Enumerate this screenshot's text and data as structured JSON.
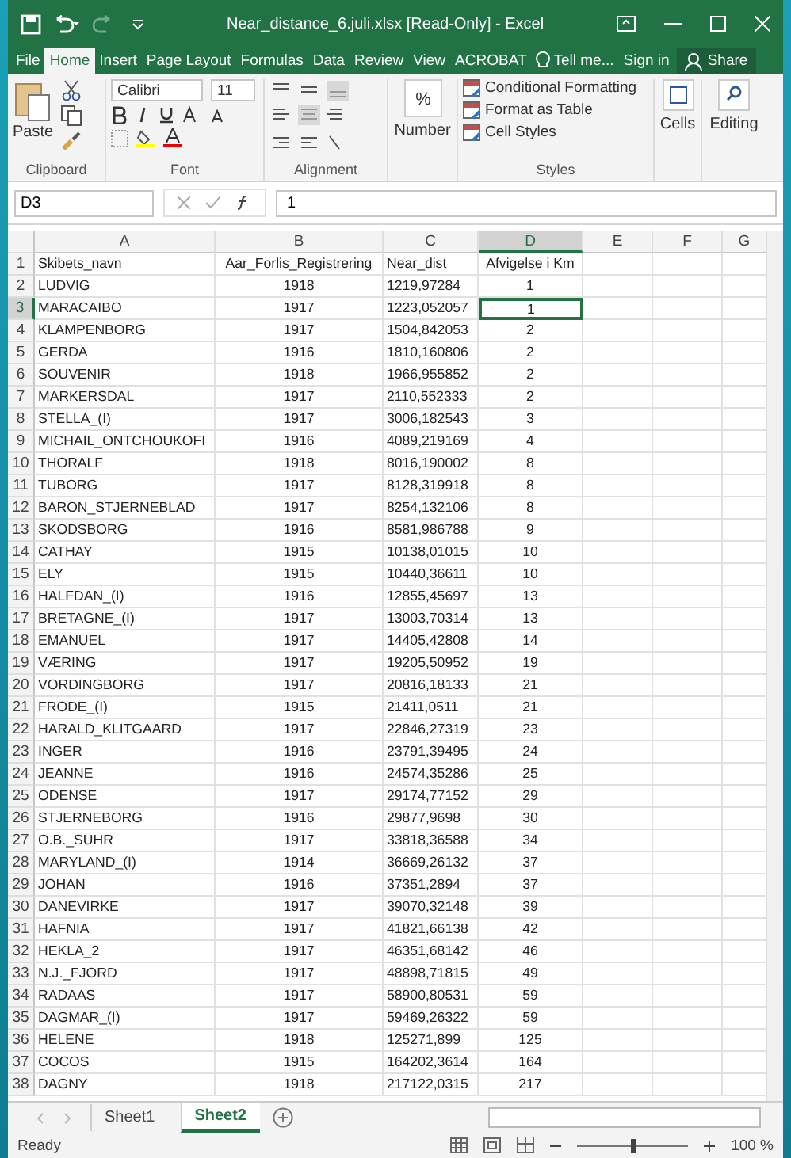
{
  "window": {
    "title": "Near_distance_6.juli.xlsx  [Read-Only] - Excel"
  },
  "ribbon_tabs": [
    {
      "label": "File",
      "selected": false
    },
    {
      "label": "Home",
      "selected": true
    },
    {
      "label": "Insert",
      "selected": false
    },
    {
      "label": "Page Layout",
      "selected": false
    },
    {
      "label": "Formulas",
      "selected": false
    },
    {
      "label": "Data",
      "selected": false
    },
    {
      "label": "Review",
      "selected": false
    },
    {
      "label": "View",
      "selected": false
    },
    {
      "label": "ACROBAT",
      "selected": false
    }
  ],
  "tell_me": "Tell me...",
  "sign_in": "Sign in",
  "share": "Share",
  "ribbon": {
    "clipboard": {
      "paste": "Paste",
      "label": "Clipboard"
    },
    "font": {
      "font_name": "Calibri",
      "font_size": "11",
      "label": "Font"
    },
    "alignment": {
      "label": "Alignment"
    },
    "number": {
      "symbol": "%",
      "button": "Number"
    },
    "styles": {
      "buttons": [
        "Conditional Formatting",
        "Format as Table",
        "Cell Styles"
      ],
      "label": "Styles"
    },
    "cells": {
      "button": "Cells"
    },
    "editing": {
      "button": "Editing"
    }
  },
  "formula_bar": {
    "name_box": "D3",
    "value": "1"
  },
  "columns": [
    {
      "label": "A",
      "selected": false
    },
    {
      "label": "B",
      "selected": false
    },
    {
      "label": "C",
      "selected": false
    },
    {
      "label": "D",
      "selected": true
    },
    {
      "label": "E",
      "selected": false
    },
    {
      "label": "F",
      "selected": false
    },
    {
      "label": "G",
      "selected": false
    }
  ],
  "rows": [
    {
      "number": "1",
      "selected": false,
      "cells": [
        "Skibets_navn",
        "Aar_Forlis_Registrering",
        "Near_dist",
        "Afvigelse i Km"
      ]
    },
    {
      "number": "2",
      "selected": false,
      "cells": [
        "LUDVIG",
        "1918",
        "1219,97284",
        "1"
      ]
    },
    {
      "number": "3",
      "selected": true,
      "cells": [
        "MARACAIBO",
        "1917",
        "1223,052057",
        "1"
      ]
    },
    {
      "number": "4",
      "selected": false,
      "cells": [
        "KLAMPENBORG",
        "1917",
        "1504,842053",
        "2"
      ]
    },
    {
      "number": "5",
      "selected": false,
      "cells": [
        "GERDA",
        "1916",
        "1810,160806",
        "2"
      ]
    },
    {
      "number": "6",
      "selected": false,
      "cells": [
        "SOUVENIR",
        "1918",
        "1966,955852",
        "2"
      ]
    },
    {
      "number": "7",
      "selected": false,
      "cells": [
        "MARKERSDAL",
        "1917",
        "2110,552333",
        "2"
      ]
    },
    {
      "number": "8",
      "selected": false,
      "cells": [
        "STELLA_(I)",
        "1917",
        "3006,182543",
        "3"
      ]
    },
    {
      "number": "9",
      "selected": false,
      "cells": [
        "MICHAIL_ONTCHOUKOFI",
        "1916",
        "4089,219169",
        "4"
      ]
    },
    {
      "number": "10",
      "selected": false,
      "cells": [
        "THORALF",
        "1918",
        "8016,190002",
        "8"
      ]
    },
    {
      "number": "11",
      "selected": false,
      "cells": [
        "TUBORG",
        "1917",
        "8128,319918",
        "8"
      ]
    },
    {
      "number": "12",
      "selected": false,
      "cells": [
        "BARON_STJERNEBLAD",
        "1917",
        "8254,132106",
        "8"
      ]
    },
    {
      "number": "13",
      "selected": false,
      "cells": [
        "SKODSBORG",
        "1916",
        "8581,986788",
        "9"
      ]
    },
    {
      "number": "14",
      "selected": false,
      "cells": [
        "CATHAY",
        "1915",
        "10138,01015",
        "10"
      ]
    },
    {
      "number": "15",
      "selected": false,
      "cells": [
        "ELY",
        "1915",
        "10440,36611",
        "10"
      ]
    },
    {
      "number": "16",
      "selected": false,
      "cells": [
        "HALFDAN_(I)",
        "1916",
        "12855,45697",
        "13"
      ]
    },
    {
      "number": "17",
      "selected": false,
      "cells": [
        "BRETAGNE_(I)",
        "1917",
        "13003,70314",
        "13"
      ]
    },
    {
      "number": "18",
      "selected": false,
      "cells": [
        "EMANUEL",
        "1917",
        "14405,42808",
        "14"
      ]
    },
    {
      "number": "19",
      "selected": false,
      "cells": [
        "VÆRING",
        "1917",
        "19205,50952",
        "19"
      ]
    },
    {
      "number": "20",
      "selected": false,
      "cells": [
        "VORDINGBORG",
        "1917",
        "20816,18133",
        "21"
      ]
    },
    {
      "number": "21",
      "selected": false,
      "cells": [
        "FRODE_(I)",
        "1915",
        "21411,0511",
        "21"
      ]
    },
    {
      "number": "22",
      "selected": false,
      "cells": [
        "HARALD_KLITGAARD",
        "1917",
        "22846,27319",
        "23"
      ]
    },
    {
      "number": "23",
      "selected": false,
      "cells": [
        "INGER",
        "1916",
        "23791,39495",
        "24"
      ]
    },
    {
      "number": "24",
      "selected": false,
      "cells": [
        "JEANNE",
        "1916",
        "24574,35286",
        "25"
      ]
    },
    {
      "number": "25",
      "selected": false,
      "cells": [
        "ODENSE",
        "1917",
        "29174,77152",
        "29"
      ]
    },
    {
      "number": "26",
      "selected": false,
      "cells": [
        "STJERNEBORG",
        "1916",
        "29877,9698",
        "30"
      ]
    },
    {
      "number": "27",
      "selected": false,
      "cells": [
        "O.B._SUHR",
        "1917",
        "33818,36588",
        "34"
      ]
    },
    {
      "number": "28",
      "selected": false,
      "cells": [
        "MARYLAND_(I)",
        "1914",
        "36669,26132",
        "37"
      ]
    },
    {
      "number": "29",
      "selected": false,
      "cells": [
        "JOHAN",
        "1916",
        "37351,2894",
        "37"
      ]
    },
    {
      "number": "30",
      "selected": false,
      "cells": [
        "DANEVIRKE",
        "1917",
        "39070,32148",
        "39"
      ]
    },
    {
      "number": "31",
      "selected": false,
      "cells": [
        "HAFNIA",
        "1917",
        "41821,66138",
        "42"
      ]
    },
    {
      "number": "32",
      "selected": false,
      "cells": [
        "HEKLA_2",
        "1917",
        "46351,68142",
        "46"
      ]
    },
    {
      "number": "33",
      "selected": false,
      "cells": [
        "N.J._FJORD",
        "1917",
        "48898,71815",
        "49"
      ]
    },
    {
      "number": "34",
      "selected": false,
      "cells": [
        "RADAAS",
        "1917",
        "58900,80531",
        "59"
      ]
    },
    {
      "number": "35",
      "selected": false,
      "cells": [
        "DAGMAR_(I)",
        "1917",
        "59469,26322",
        "59"
      ]
    },
    {
      "number": "36",
      "selected": false,
      "cells": [
        "HELENE",
        "1918",
        "125271,899",
        "125"
      ]
    },
    {
      "number": "37",
      "selected": false,
      "cells": [
        "COCOS",
        "1915",
        "164202,3614",
        "164"
      ]
    },
    {
      "number": "38",
      "selected": false,
      "cells": [
        "DAGNY",
        "1918",
        "217122,0315",
        "217"
      ]
    }
  ],
  "sheet_tabs": [
    {
      "label": "Sheet1",
      "selected": false
    },
    {
      "label": "Sheet2",
      "selected": true
    }
  ],
  "status_bar": {
    "status": "Ready",
    "zoom": "100 %",
    "zoom_slider": {
      "level": 0.5
    }
  }
}
